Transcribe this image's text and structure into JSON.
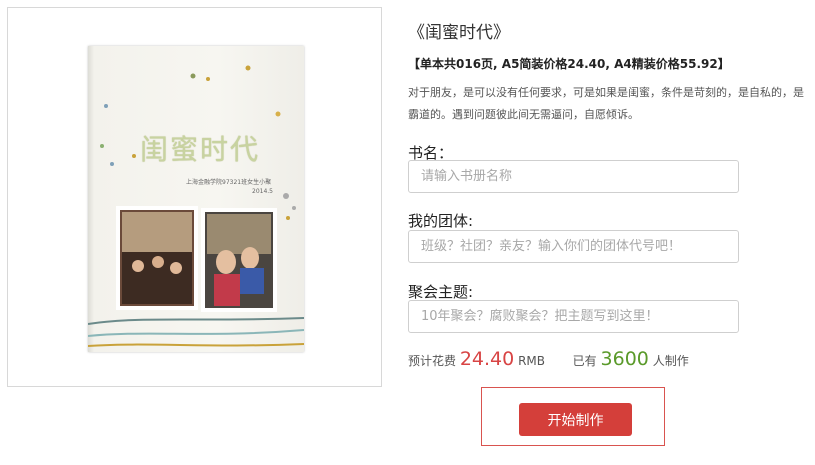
{
  "product": {
    "title": "《闺蜜时代》",
    "price_line": "【单本共016页, A5简装价格24.40, A4精装价格55.92】",
    "description": "对于朋友，是可以没有任何要求，可是如果是闺蜜，条件是苛刻的，是自私的，是霸道的。遇到问题彼此间无需逼问，自愿倾诉。"
  },
  "cover": {
    "title": "闺蜜时代",
    "subtitle": "上海金融学院97321班女生小聚",
    "date": "2014.5"
  },
  "form": {
    "book_name_label": "书名：",
    "book_name_placeholder": "请输入书册名称",
    "group_label": "我的团体:",
    "group_placeholder": "班级？社团？亲友？输入你们的团体代号吧！",
    "theme_label": "聚会主题:",
    "theme_placeholder": "10年聚会？腐败聚会？把主题写到这里！"
  },
  "stats": {
    "cost_label": "预计花费",
    "cost_value": "24.40",
    "cost_unit": "RMB",
    "made_prefix": "已有",
    "made_count": "3600",
    "made_suffix": "人制作"
  },
  "action": {
    "start_label": "开始制作"
  },
  "colors": {
    "accent_red": "#d43f3a",
    "count_green": "#5a9a2a",
    "price_red": "#d84444"
  }
}
